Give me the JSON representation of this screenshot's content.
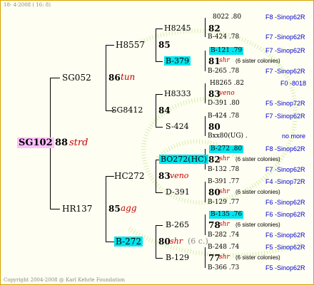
{
  "header": {
    "date": "18- 4-2008 ( 16: 8)"
  },
  "footer": {
    "copyright": "Copyright 2004-2008 @ Karl Kehrle Foundation"
  },
  "root": {
    "id": "SG102",
    "num": "88",
    "note": "strd"
  },
  "gen1": [
    {
      "id": "SG052",
      "num": "86",
      "note": "tun"
    },
    {
      "id": "HR137",
      "num": "85",
      "note": "agg"
    }
  ],
  "gen2": [
    {
      "id": "H8557",
      "num": "85"
    },
    {
      "id": "SG8412",
      "num": "84"
    },
    {
      "id": "HC272",
      "num": "83",
      "note": "veno"
    },
    {
      "id": "B-272",
      "num": "80",
      "note": "shr",
      "extra": "(6 c.)"
    }
  ],
  "gen3": [
    {
      "id": "H8245",
      "num": "82"
    },
    {
      "id": "B-379",
      "num": "81",
      "note": "shr",
      "extra": "(6 sister colonies)"
    },
    {
      "id": "H8333",
      "num": "83",
      "note": "veno"
    },
    {
      "id": "S-424",
      "num": "80"
    },
    {
      "id": "BO272(HC)",
      "num": "82",
      "note": "shr",
      "extra": "(6 sister colonies)"
    },
    {
      "id": "D-391",
      "num": "80",
      "note": "shr",
      "extra": "(6 sister colonies)"
    },
    {
      "id": "B-265",
      "num": "78",
      "note": "shr",
      "extra": "(6 sister colonies)"
    },
    {
      "id": "B-129",
      "num": "77",
      "note": "shr",
      "extra": "(6 sister colonies)"
    }
  ],
  "gen4": [
    {
      "id": "8022 .80",
      "place": "F8 -Sinop62R"
    },
    {
      "id": "B-424 .78",
      "place": "F7 -Sinop62R"
    },
    {
      "id": "B-121 .79",
      "place": "F7 -Sinop62R"
    },
    {
      "id": "B-265 .78",
      "place": "F7 -Sinop62R"
    },
    {
      "id": "H8265 .82",
      "place": "F0 -8018"
    },
    {
      "id": "D-391 .80",
      "place": "F5 -Sinop72R"
    },
    {
      "id": "B-424 .78",
      "place": "F7 -Sinop62R"
    },
    {
      "id": "Bxx80(UG) .",
      "place": "no more"
    },
    {
      "id": "B-272 .80",
      "place": "F8 -Sinop62R"
    },
    {
      "id": "B-132 .78",
      "place": "F7 -Sinop62R"
    },
    {
      "id": "B-391 .77",
      "place": "F4 -Sinop72R"
    },
    {
      "id": "B-129 .77",
      "place": "F6 -Sinop62R"
    },
    {
      "id": "B-135 .76",
      "place": "F6 -Sinop62R"
    },
    {
      "id": "B-282 .74",
      "place": "F6 -Sinop62R"
    },
    {
      "id": "B-248 .74",
      "place": "F5 -Sinop62R"
    },
    {
      "id": "B-366 .73",
      "place": "F5 -Sinop62R"
    }
  ]
}
